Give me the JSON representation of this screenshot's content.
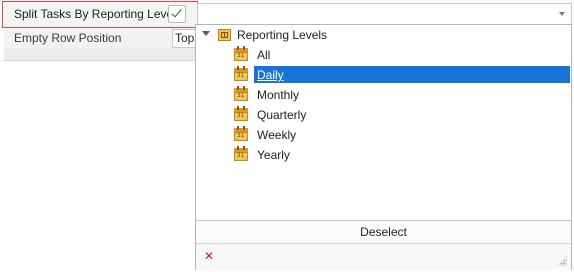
{
  "property_grid": {
    "rows": [
      {
        "label": "Split Tasks By Reporting Level",
        "checked": true
      },
      {
        "label": "Empty Row Position",
        "value": "Top"
      }
    ]
  },
  "combo": {
    "value": "",
    "dropdown_icon": "chevron-down-icon"
  },
  "popup": {
    "tree": {
      "root": {
        "label": "Reporting Levels",
        "icon": "folder-grid-icon",
        "expanded": true
      },
      "items": [
        {
          "label": "All",
          "icon": "calendar-icon",
          "selected": false
        },
        {
          "label": "Daily",
          "icon": "calendar-icon",
          "selected": true
        },
        {
          "label": "Monthly",
          "icon": "calendar-icon",
          "selected": false
        },
        {
          "label": "Quarterly",
          "icon": "calendar-icon",
          "selected": false
        },
        {
          "label": "Weekly",
          "icon": "calendar-icon",
          "selected": false
        },
        {
          "label": "Yearly",
          "icon": "calendar-icon",
          "selected": false
        }
      ]
    },
    "deselect_label": "Deselect",
    "close_icon": "close-icon",
    "resize_icon": "resize-grip-icon"
  },
  "colors": {
    "selection": "#1a73d8",
    "highlight_border": "#e34b4b",
    "close": "#d01f1f"
  }
}
